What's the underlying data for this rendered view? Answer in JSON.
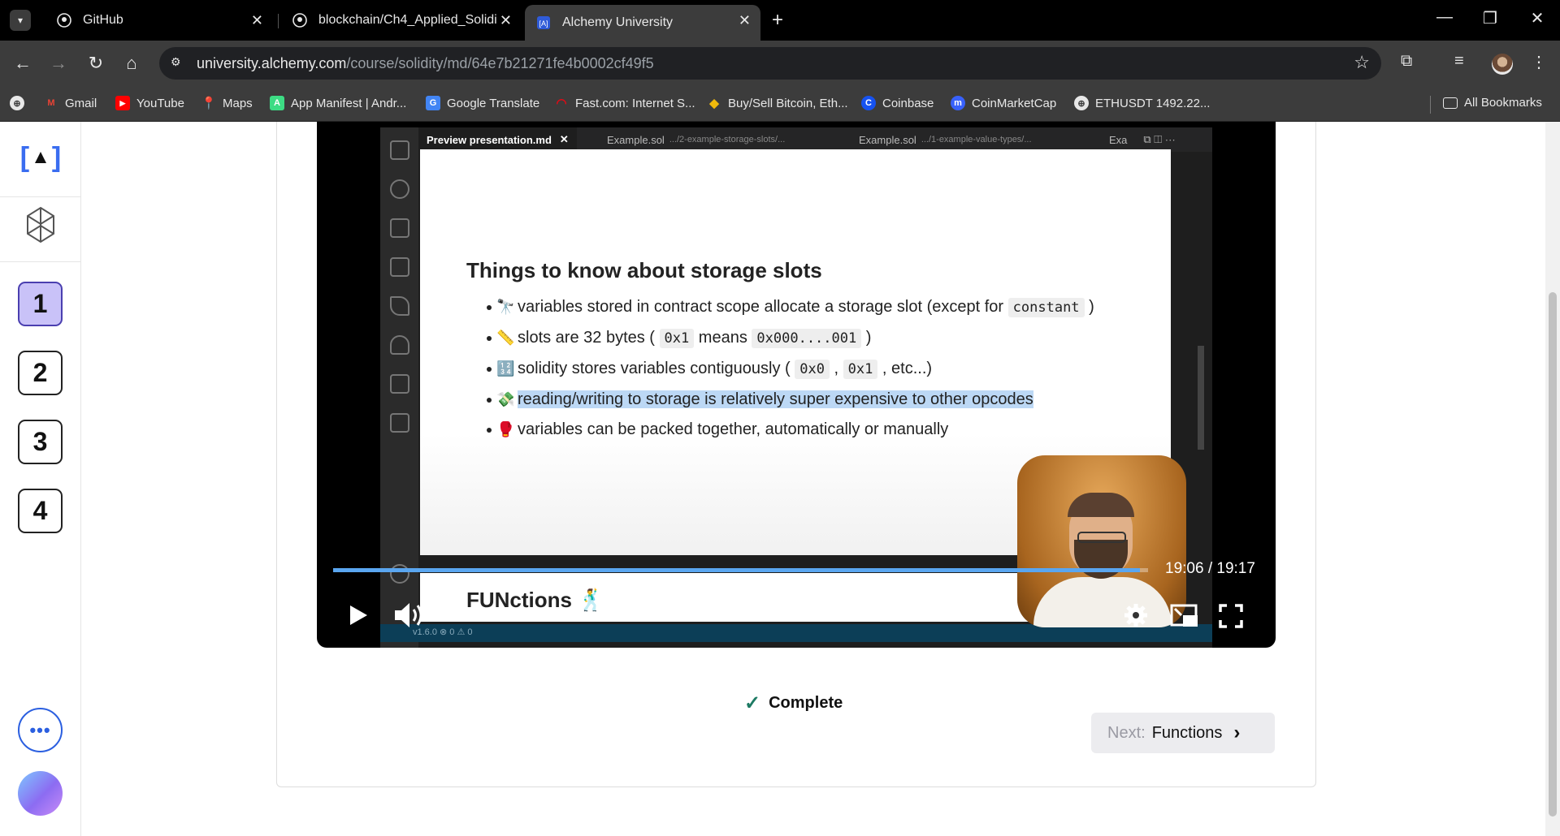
{
  "browser": {
    "tabs": [
      {
        "title": "GitHub",
        "icon": "github-icon"
      },
      {
        "title": "blockchain/Ch4_Applied_Solidit",
        "icon": "github-icon"
      },
      {
        "title": "Alchemy University",
        "icon": "alchemy-icon",
        "active": true
      }
    ],
    "url_host": "university.alchemy.com",
    "url_path": "/course/solidity/md/64e7b21271fe4b0002cf49f5",
    "bookmarks": [
      {
        "label": "Gmail",
        "icon": "gmail-icon",
        "color": "#ea4335"
      },
      {
        "label": "YouTube",
        "icon": "youtube-icon",
        "color": "#ff0000"
      },
      {
        "label": "Maps",
        "icon": "maps-icon",
        "color": "#34a853"
      },
      {
        "label": "App Manifest | Andr...",
        "icon": "android-icon",
        "color": "#3ddc84"
      },
      {
        "label": "Google Translate",
        "icon": "translate-icon",
        "color": "#4285f4"
      },
      {
        "label": "Fast.com: Internet S...",
        "icon": "fast-icon",
        "color": "#e50914"
      },
      {
        "label": "Buy/Sell Bitcoin, Eth...",
        "icon": "binance-icon",
        "color": "#f0b90b"
      },
      {
        "label": "Coinbase",
        "icon": "coinbase-icon",
        "color": "#1652f0"
      },
      {
        "label": "CoinMarketCap",
        "icon": "coinmarketcap-icon",
        "color": "#3861fb"
      },
      {
        "label": "ETHUSDT 1492.22...",
        "icon": "globe-icon",
        "color": "#e8e8e8"
      }
    ],
    "all_bookmarks": "All Bookmarks"
  },
  "sidebar": {
    "steps": [
      "1",
      "2",
      "3",
      "4"
    ],
    "active_step": "1",
    "more_label": "•••"
  },
  "video": {
    "editor_tabs": [
      {
        "name": "Preview presentation.md",
        "path": "",
        "active": true
      },
      {
        "name": "Example.sol",
        "path": ".../2-example-storage-slots/..."
      },
      {
        "name": "Example.sol",
        "path": ".../1-example-value-types/..."
      },
      {
        "name": "Exa",
        "path": ""
      }
    ],
    "slide_heading": "Things to know about storage slots",
    "bullets": [
      {
        "emoji": "🔭",
        "pre": "variables stored in contract scope allocate a storage slot (except for ",
        "code": "constant",
        "post": " )"
      },
      {
        "emoji": "📏",
        "pre": "slots are 32 bytes ( ",
        "code": "0x1",
        "mid": " means ",
        "code2": "0x000....001",
        "post": " )"
      },
      {
        "emoji": "🔢",
        "pre": "solidity stores variables contiguously ( ",
        "code": "0x0",
        "mid": " , ",
        "code2": "0x1",
        "post": " , etc...)"
      },
      {
        "emoji": "💸",
        "highlight": "reading/writing to storage is relatively super expensive to other opcodes"
      },
      {
        "emoji": "🥊",
        "pre": "variables can be packed together, automatically or manually"
      }
    ],
    "next_heading": "FUNctions 🕺",
    "status_text": "v1.6.0   ⊗ 0 ⚠ 0",
    "progress": 0.9904,
    "timecode": "19:06 / 19:17"
  },
  "lesson": {
    "complete_label": "Complete",
    "next_prefix": "Next:",
    "next_title": "Functions"
  },
  "colors": {
    "accent": "#2b5fe0",
    "active_step_bg": "#c9c2f8",
    "progress": "#5aa6f0",
    "check": "#1d7a63"
  }
}
